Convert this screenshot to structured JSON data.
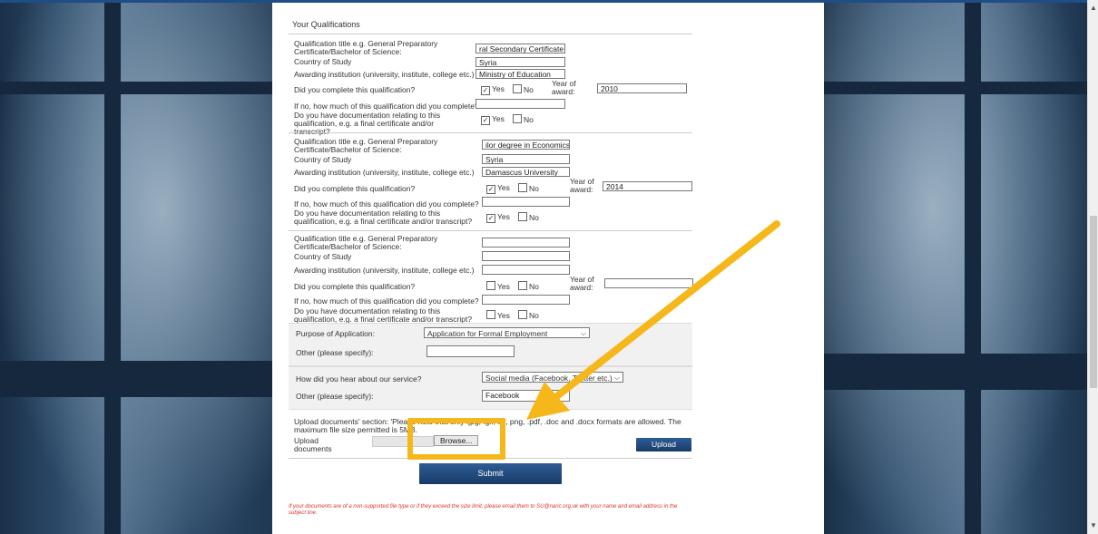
{
  "section_title": "Your Qualifications",
  "labels": {
    "qual_title": "Qualification title e.g. General Preparatory Certificate/Bachelor of Science:",
    "country": "Country of Study",
    "institution": "Awarding institution (university, institute, college etc.)",
    "completed": "Did you complete this qualification?",
    "year_award": "Year of award:",
    "how_much": "If no, how much of this qualification did you complete?",
    "documentation": "Do you have documentation relating to this qualification, e.g. a final certificate and/or transcript?",
    "yes": "Yes",
    "no": "No"
  },
  "qualifications": [
    {
      "title": "ral Secondary Certificate",
      "country": "Syria",
      "institution": "Ministry of Education",
      "completed_yes": "✓",
      "year": "2010",
      "how_much": "",
      "docs_yes": "✓"
    },
    {
      "title": "ilor degree in Economics",
      "country": "Syria",
      "institution": "Damascus University",
      "completed_yes": "✓",
      "year": "2014",
      "how_much": "",
      "docs_yes": "✓"
    },
    {
      "title": "",
      "country": "",
      "institution": "",
      "completed_yes": "",
      "year": "",
      "how_much": "",
      "docs_yes": ""
    }
  ],
  "purpose": {
    "label": "Purpose of Application:",
    "value": "Application for Formal Employment",
    "other_label": "Other (please specify):",
    "other_value": ""
  },
  "hear": {
    "label": "How did you hear about our service?",
    "value": "Social media (Facebook, Twitter etc.)",
    "other_label": "Other (please specify):",
    "other_value": "Facebook"
  },
  "upload": {
    "text": "Upload documents' section: 'Please note that only .jpg, .gif, tiff, png, .pdf, .doc and .docx formats are allowed. The maximum file size permitted is 5MB.",
    "field_label": "Upload documents",
    "browse_label": "Browse...",
    "upload_label": "Upload"
  },
  "submit_label": "Submit",
  "note": "If your documents are of a non-supported file type or if they exceed the size limit, please email them to SU@naric.org.uk with your name and email address in the subject line.",
  "colors": {
    "highlight": "#f6b71a",
    "button": "#1f4777",
    "note": "#e0332b"
  }
}
